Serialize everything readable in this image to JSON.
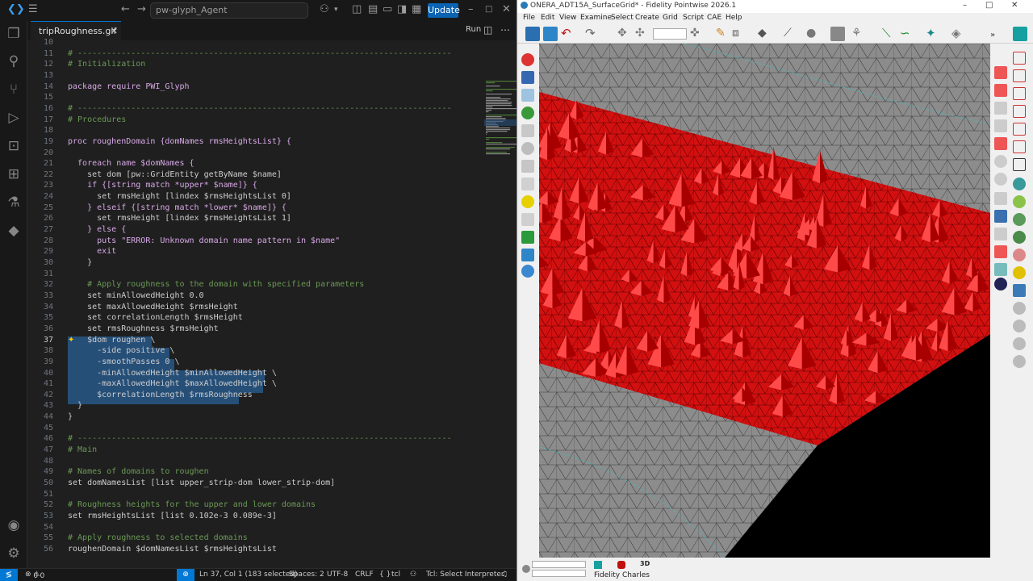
{
  "vscode": {
    "search_text": "pw-glyph_Agent",
    "update_label": "Update",
    "tab_label": "tripRoughness.glf",
    "run_label": "Run",
    "status": {
      "errors": "0",
      "warnings": "0",
      "cursor": "Ln 37, Col 1 (183 selected)",
      "spaces": "Spaces: 2",
      "encoding": "UTF-8",
      "eol": "CRLF",
      "lang_braces": "{ }",
      "language": "tcl",
      "interpreter": "Tcl: Select Interpreter"
    },
    "line_numbers": [
      "10",
      "11",
      "12",
      "13",
      "14",
      "15",
      "16",
      "17",
      "18",
      "19",
      "20",
      "21",
      "22",
      "23",
      "24",
      "25",
      "26",
      "27",
      "28",
      "29",
      "30",
      "31",
      "32",
      "33",
      "34",
      "35",
      "36",
      "37",
      "38",
      "39",
      "40",
      "41",
      "42",
      "43",
      "44",
      "45",
      "46",
      "47",
      "48",
      "49",
      "50",
      "51",
      "52",
      "53",
      "54",
      "55",
      "56"
    ],
    "code_lines": [
      "# -----------------------------------------------------------------------------",
      "# Initialization",
      "",
      "package require PWI_Glyph",
      "",
      "# -----------------------------------------------------------------------------",
      "# Procedures",
      "",
      "proc roughenDomain {domNames rmsHeightsList} {",
      "",
      "  foreach name $domNames {",
      "    set dom [pw::GridEntity getByName $name]",
      "    if {[string match *upper* $name]} {",
      "      set rmsHeight [lindex $rmsHeightsList 0]",
      "    } elseif {[string match *lower* $name]} {",
      "      set rmsHeight [lindex $rmsHeightsList 1]",
      "    } else {",
      "      puts \"ERROR: Unknown domain name pattern in $name\"",
      "      exit",
      "    }",
      "",
      "    # Apply roughness to the domain with specified parameters",
      "    set minAllowedHeight 0.0",
      "    set maxAllowedHeight $rmsHeight",
      "    set correlationLength $rmsHeight",
      "    set rmsRoughness $rmsHeight",
      "    $dom roughen \\",
      "      -side positive \\",
      "      -smoothPasses 0 \\",
      "      -minAllowedHeight $minAllowedHeight \\",
      "      -maxAllowedHeight $maxAllowedHeight \\",
      "      $correlationLength $rmsRoughness",
      "  }",
      "}",
      "",
      "# -----------------------------------------------------------------------------",
      "# Main",
      "",
      "# Names of domains to roughen",
      "set domNamesList [list upper_strip-dom lower_strip-dom]",
      "",
      "# Roughness heights for the upper and lower domains",
      "set rmsHeightsList [list 0.102e-3 0.089e-3]",
      "",
      "# Apply roughness to selected domains",
      "roughenDomain $domNamesList $rmsHeightsList",
      ""
    ]
  },
  "pointwise": {
    "title": "ONERA_ADT15A_SurfaceGrid* - Fidelity Pointwise 2026.1",
    "menu": [
      "File",
      "Edit",
      "View",
      "Examine",
      "Select",
      "Create",
      "Grid",
      "Script",
      "CAE",
      "Help"
    ],
    "status_label": "Fidelity Charles",
    "status_3d": "3D"
  },
  "colors": {
    "vscode_accent": "#0078d4",
    "update_button": "#0a63b3",
    "mesh_red": "#e01010",
    "mesh_gray": "#8c8c8c"
  }
}
